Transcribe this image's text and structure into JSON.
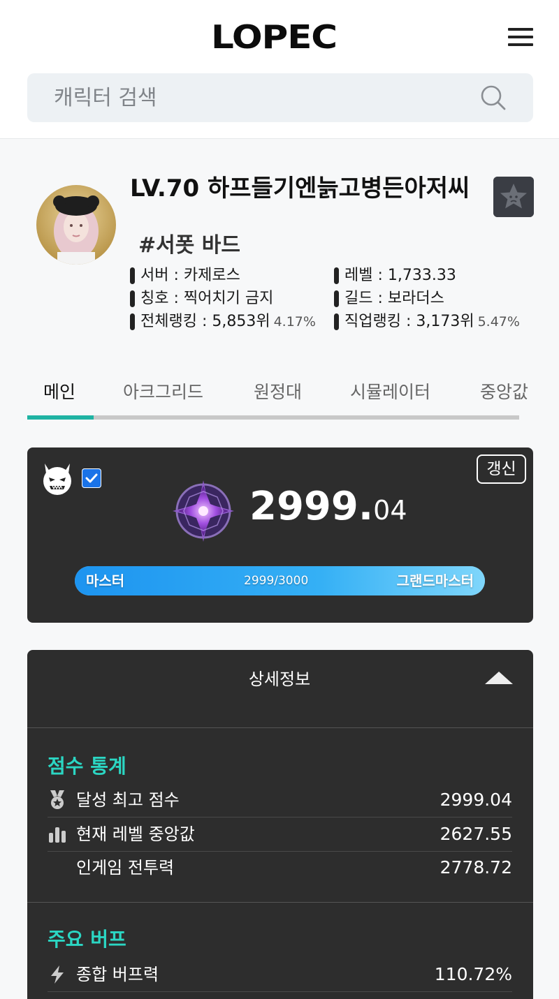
{
  "header": {
    "logo": "LOPEC"
  },
  "search": {
    "placeholder": "캐릭터 검색"
  },
  "profile": {
    "name": "LV.70 하프들기엔늙고병든아저씨",
    "class_tag": "#서폿 바드",
    "server_label": "서버 : 카제로스",
    "level_label": "레벨 : 1,733.33",
    "title_label": "칭호 : 찍어치기 금지",
    "guild_label": "길드 : 보라더스",
    "total_rank_label": "전체랭킹 : 5,853위",
    "total_rank_pct": "4.17%",
    "class_rank_label": "직업랭킹 : 3,173위",
    "class_rank_pct": "5.47%"
  },
  "tabs": [
    "메인",
    "아크그리드",
    "원정대",
    "시뮬레이터",
    "중앙값"
  ],
  "score_card": {
    "refresh_label": "갱신",
    "score_int": "2999.",
    "score_dec": "04",
    "tier_current": "마스터",
    "tier_next": "그랜드마스터",
    "progress_text": "2999/3000",
    "progress_fraction": 0.9997,
    "checkbox_checked": true
  },
  "detail": {
    "title": "상세정보",
    "sections": [
      {
        "heading": "점수 통계",
        "rows": [
          {
            "icon": "medal-icon",
            "label": "달성 최고 점수",
            "value": "2999.04"
          },
          {
            "icon": "bar-chart-icon",
            "label": "현재 레벨 중앙값",
            "value": "2627.55"
          },
          {
            "icon": "",
            "label": "인게임 전투력",
            "value": "2778.72"
          }
        ]
      },
      {
        "heading": "주요 버프",
        "rows": [
          {
            "icon": "lightning-icon",
            "label": "종합 버프력",
            "value": "110.72%"
          }
        ]
      }
    ]
  },
  "colors": {
    "accent": "#2bd6c3",
    "card_bg": "#2d2d2d",
    "progress": "#1d94f0",
    "checkbox": "#1a73e8"
  }
}
